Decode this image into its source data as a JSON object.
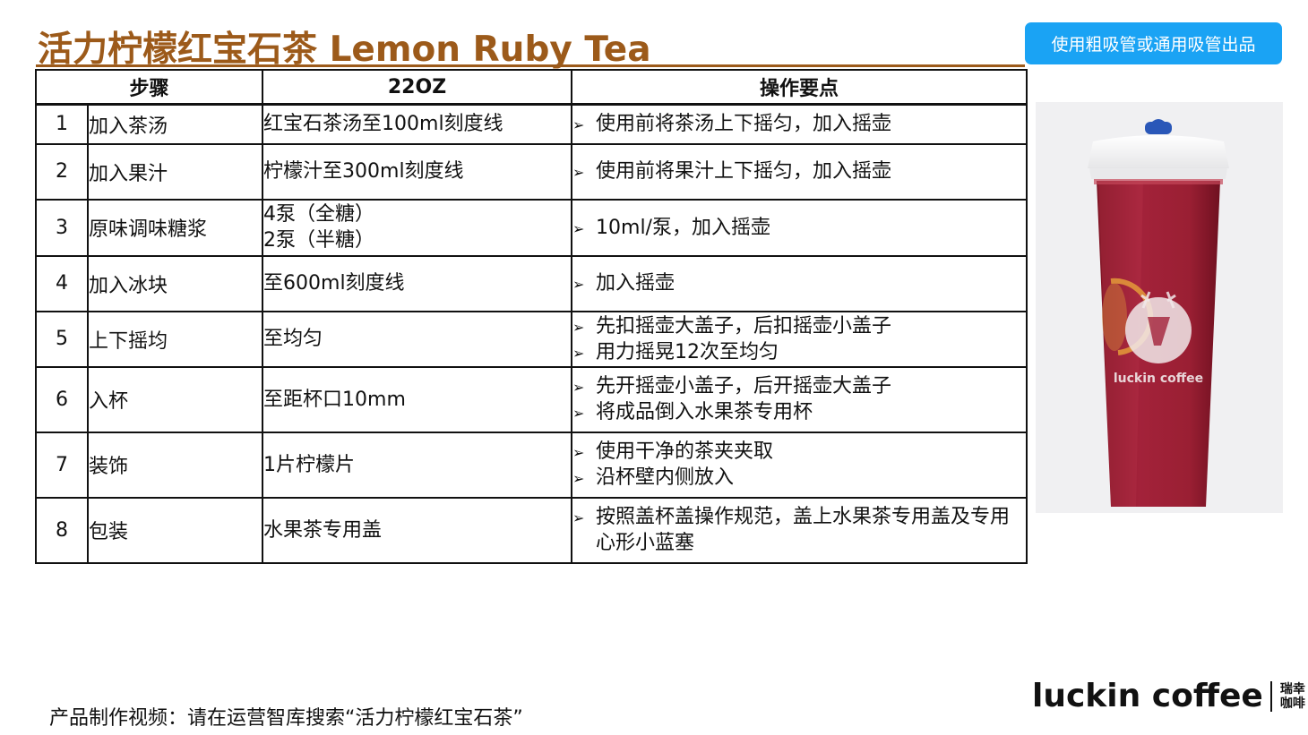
{
  "title": "活力柠檬红宝石茶 Lemon Ruby Tea",
  "badge": "使用粗吸管或通用吸管出品",
  "table": {
    "headers": {
      "step": "步骤",
      "size": "22OZ",
      "points": "操作要点"
    },
    "rows": [
      {
        "num": "1",
        "step": "加入茶汤",
        "value": [
          "红宝石茶汤至100ml刻度线"
        ],
        "points": [
          "使用前将茶汤上下摇匀，加入摇壶"
        ]
      },
      {
        "num": "2",
        "step": "加入果汁",
        "value": [
          "柠檬汁至300ml刻度线"
        ],
        "points": [
          "使用前将果汁上下摇匀，加入摇壶"
        ]
      },
      {
        "num": "3",
        "step": "原味调味糖浆",
        "value": [
          "4泵（全糖）",
          "2泵（半糖）"
        ],
        "points": [
          "10ml/泵，加入摇壶"
        ]
      },
      {
        "num": "4",
        "step": "加入冰块",
        "value": [
          "至600ml刻度线"
        ],
        "points": [
          "加入摇壶"
        ]
      },
      {
        "num": "5",
        "step": "上下摇均",
        "value": [
          "至均匀"
        ],
        "points": [
          "先扣摇壶大盖子，后扣摇壶小盖子",
          "用力摇晃12次至均匀"
        ]
      },
      {
        "num": "6",
        "step": "入杯",
        "value": [
          "至距杯口10mm"
        ],
        "points": [
          "先开摇壶小盖子，后开摇壶大盖子",
          "将成品倒入水果茶专用杯"
        ]
      },
      {
        "num": "7",
        "step": "装饰",
        "value": [
          "1片柠檬片"
        ],
        "points": [
          "使用干净的茶夹夹取",
          "沿杯壁内侧放入"
        ]
      },
      {
        "num": "8",
        "step": "包装",
        "value": [
          "水果茶专用盖"
        ],
        "points": [
          "按照盖杯盖操作规范，盖上水果茶专用盖及专用心形小蓝塞"
        ]
      }
    ]
  },
  "photo": {
    "cup_logo_text": "luckin coffee"
  },
  "footer": {
    "note": "产品制作视频：请在运营智库搜索“活力柠檬红宝石茶”"
  },
  "brand": {
    "wordmark": "luckin coffee",
    "cn_line1": "瑞幸",
    "cn_line2": "咖啡"
  },
  "colors": {
    "title": "#9c5a1a",
    "badge": "#1aa3f4",
    "tea": "#9a1f2e"
  },
  "icons": {
    "bullet": "arrow-bullet-icon"
  }
}
